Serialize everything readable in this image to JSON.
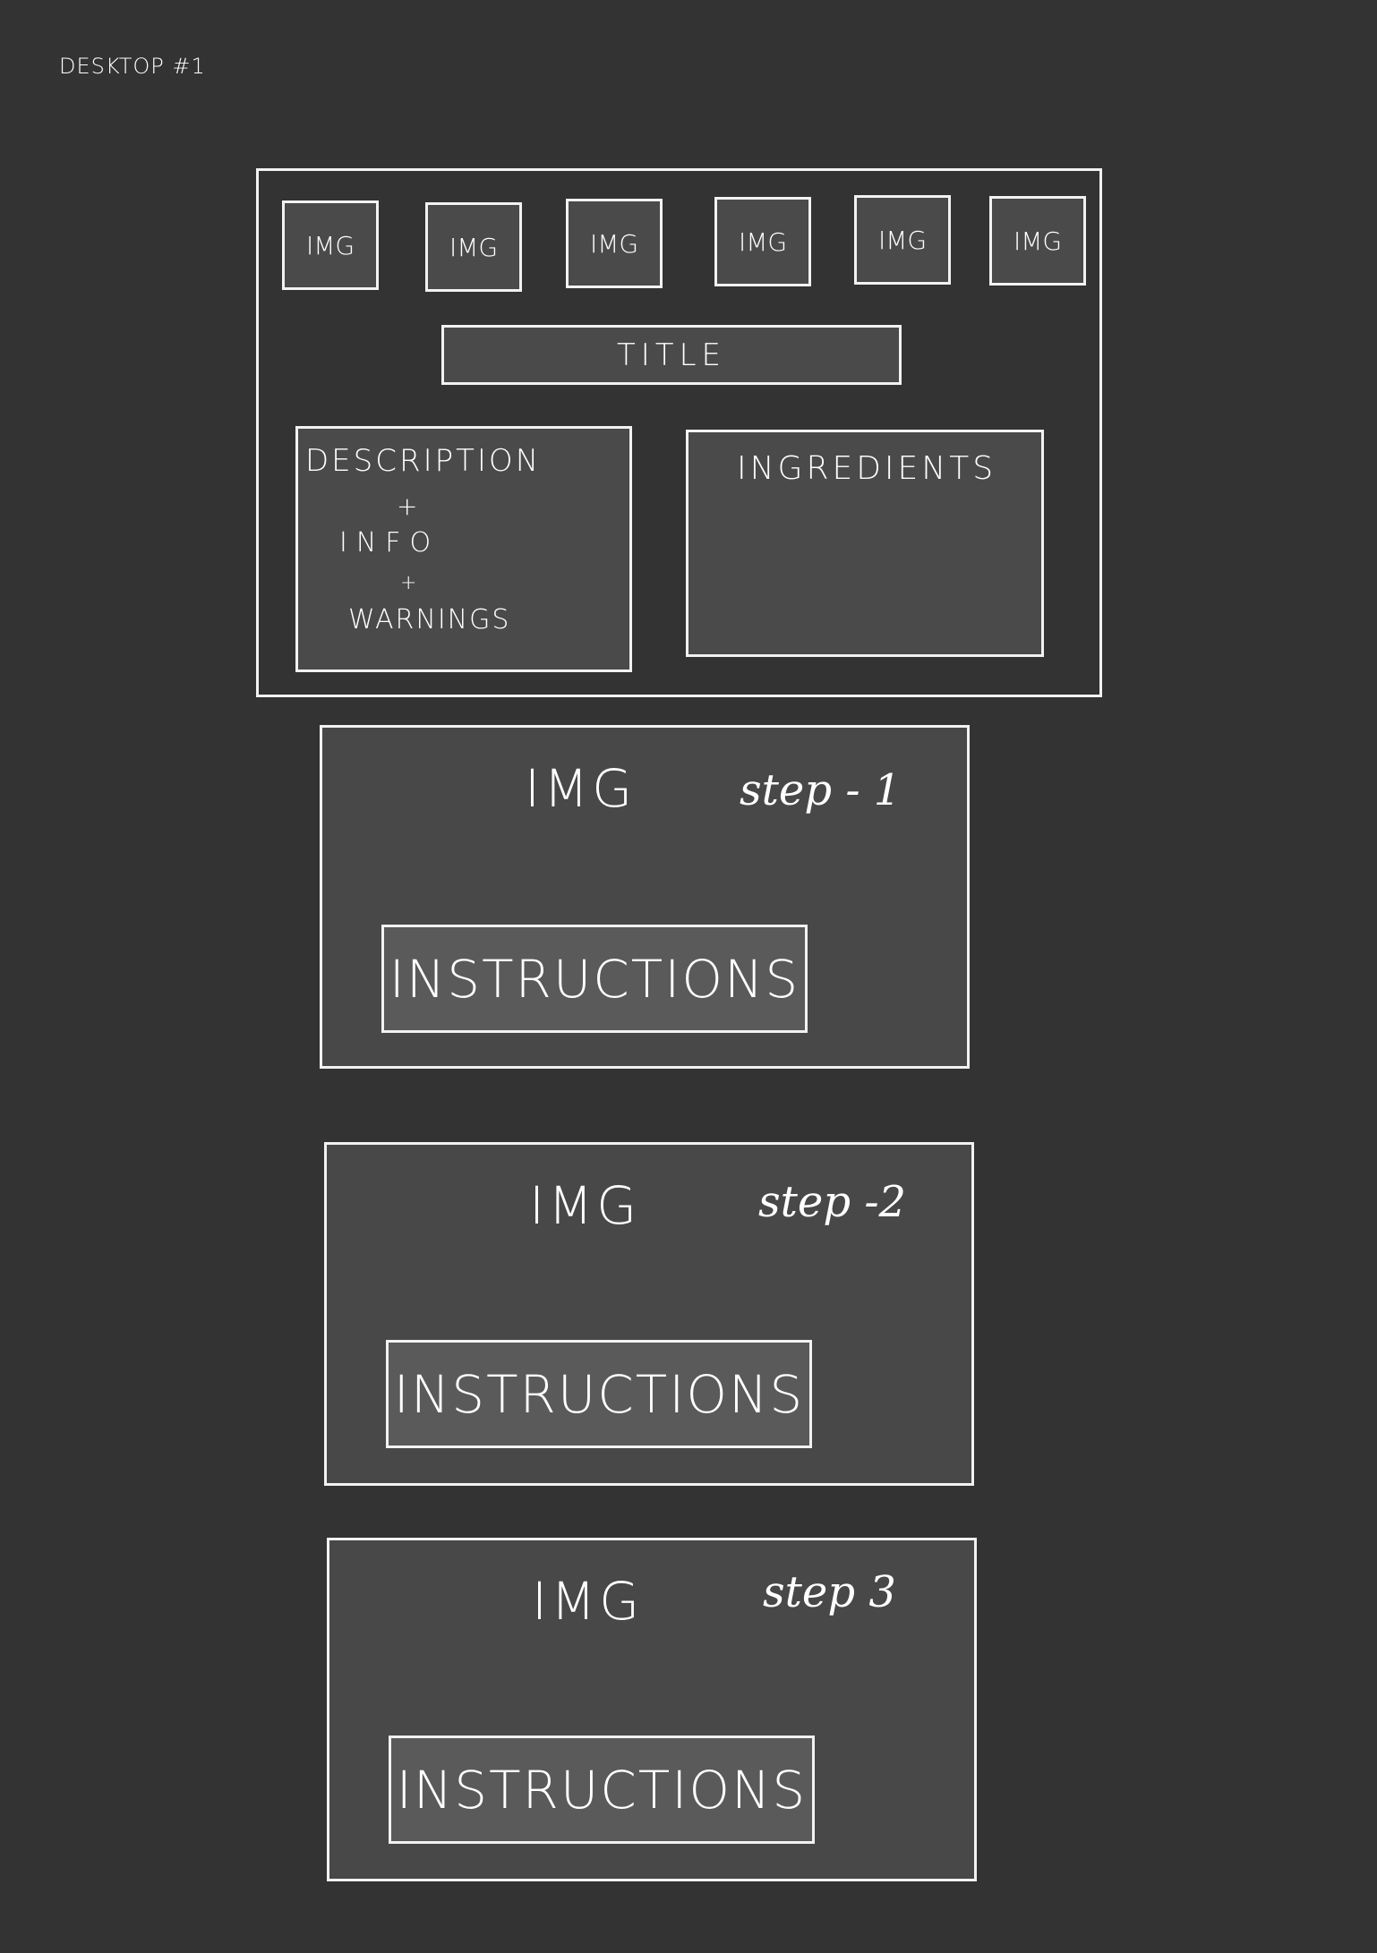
{
  "page_label": "DESKTOP #1",
  "header": {
    "thumbnails": [
      "IMG",
      "IMG",
      "IMG",
      "IMG",
      "IMG",
      "IMG"
    ],
    "title": "TITLE",
    "description_lines": [
      "DESCRIPTION",
      "+",
      "INFO",
      "+",
      "WARNINGS"
    ],
    "ingredients": "INGREDIENTS"
  },
  "steps": [
    {
      "img": "IMG",
      "label": "step - 1",
      "instructions": "INSTRUCTIONS"
    },
    {
      "img": "IMG",
      "label": "step -2",
      "instructions": "INSTRUCTIONS"
    },
    {
      "img": "IMG",
      "label": "step 3",
      "instructions": "INSTRUCTIONS"
    }
  ],
  "colors": {
    "background": "#333333",
    "panel": "#4a4a4a",
    "stroke": "#f2f2f2"
  }
}
